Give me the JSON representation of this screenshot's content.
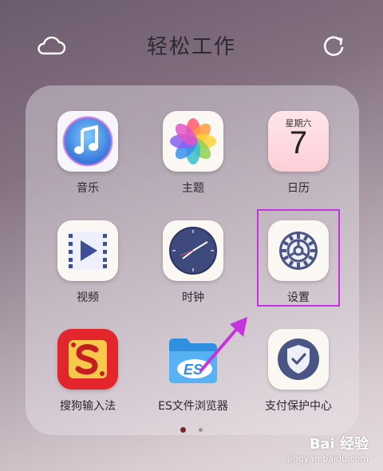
{
  "header": {
    "title": "轻松工作",
    "left_icon": "cloud-icon",
    "right_icon": "refresh-icon"
  },
  "apps": [
    {
      "label": "音乐",
      "icon": "music-icon"
    },
    {
      "label": "主题",
      "icon": "theme-icon"
    },
    {
      "label": "日历",
      "icon": "calendar-icon",
      "weekday": "星期六",
      "day": "7"
    },
    {
      "label": "视频",
      "icon": "video-icon"
    },
    {
      "label": "时钟",
      "icon": "clock-icon"
    },
    {
      "label": "设置",
      "icon": "settings-icon"
    },
    {
      "label": "搜狗输入法",
      "icon": "sogou-input-icon"
    },
    {
      "label": "ES文件浏览器",
      "icon": "es-file-explorer-icon"
    },
    {
      "label": "支付保护中心",
      "icon": "payment-protection-icon"
    }
  ],
  "pager": {
    "current": 1,
    "total": 2
  },
  "watermark": {
    "brand": "Bai 经验",
    "url": "jingyan.baidu.com"
  },
  "colors": {
    "highlight": "#c533dc",
    "accent_dot": "#6e2a2a"
  }
}
